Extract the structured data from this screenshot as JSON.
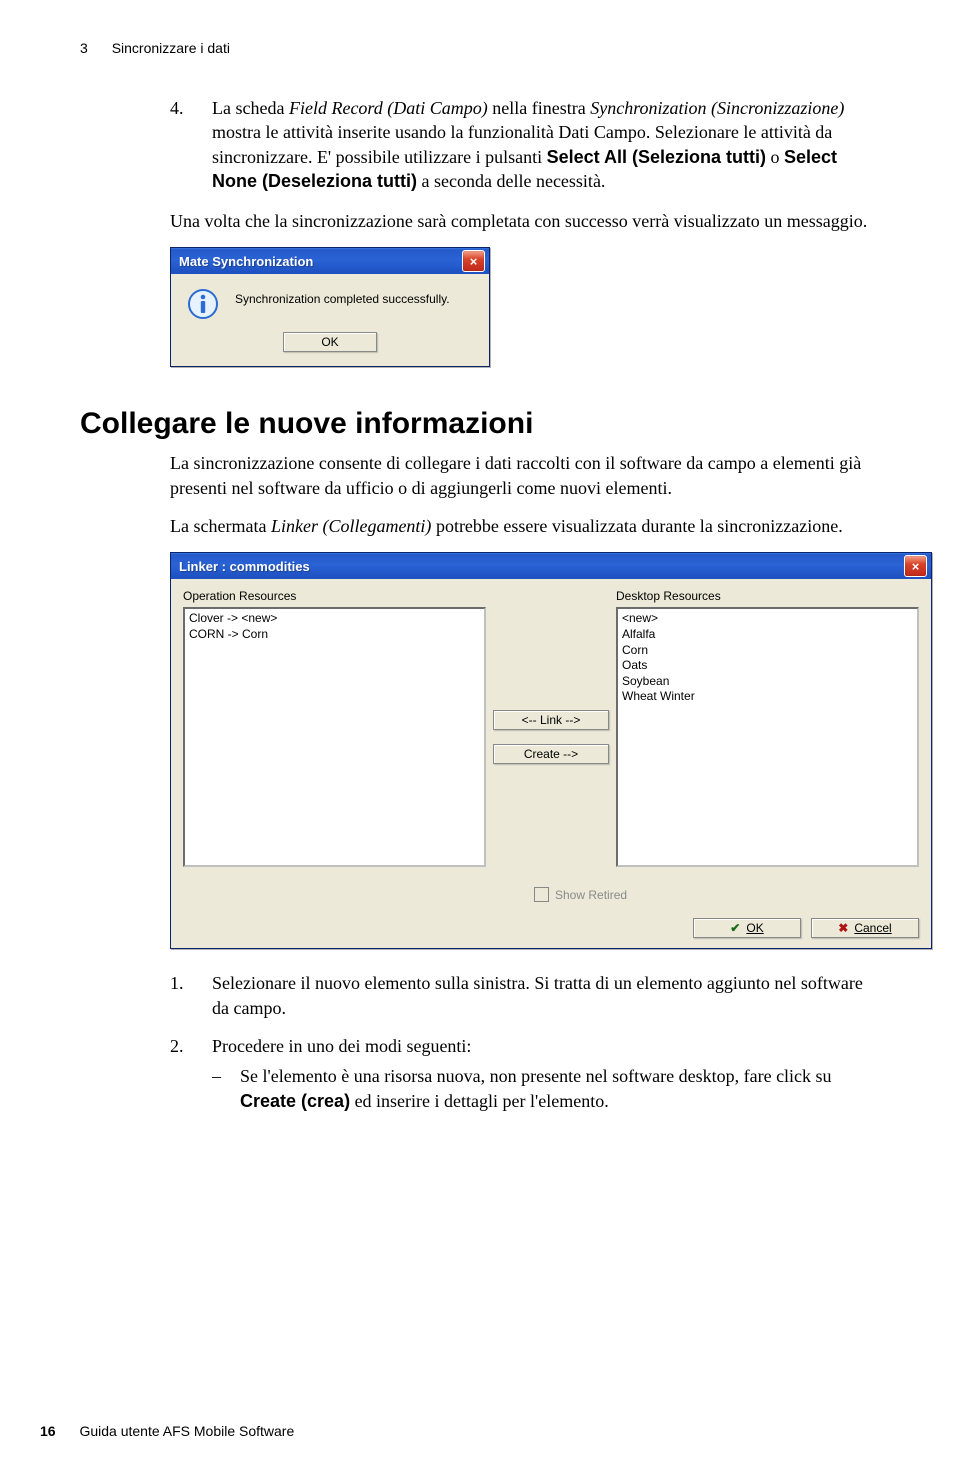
{
  "header": {
    "chapter_num": "3",
    "chapter_title": "Sincronizzare i dati"
  },
  "step4": {
    "num": "4.",
    "part1": "La scheda ",
    "italic1": "Field Record (Dati Campo)",
    "part2": " nella finestra ",
    "italic2": "Synchronization (Sincronizzazione)",
    "part3": " mostra le attività inserite usando la funzionalità Dati Campo. Selezionare le attività da sincronizzare. E' possibile utilizzare i pulsanti ",
    "bold1": "Select All (Seleziona tutti)",
    "part4": " o ",
    "bold2": "Select None (Deseleziona tutti)",
    "part5": " a seconda delle necessità."
  },
  "after_step4": "Una volta che la sincronizzazione sarà completata con successo verrà visualizzato un messaggio.",
  "msgbox": {
    "title": "Mate Synchronization",
    "text": "Synchronization completed successfully.",
    "ok": "OK"
  },
  "section_heading": "Collegare le nuove informazioni",
  "section_p1": "La sincronizzazione consente di collegare i dati raccolti con il software da campo a elementi già presenti nel software da ufficio o di aggiungerli come nuovi elementi.",
  "section_p2_a": "La schermata ",
  "section_p2_i": "Linker (Collegamenti)",
  "section_p2_b": " potrebbe essere visualizzata durante la sincronizzazione.",
  "linker": {
    "title": "Linker : commodities",
    "left_label": "Operation Resources",
    "right_label": "Desktop Resources",
    "left_items": [
      "Clover -> <new>",
      "CORN -> Corn"
    ],
    "right_items": [
      "<new>",
      "Alfalfa",
      "Corn",
      "Oats",
      "Soybean",
      "Wheat Winter"
    ],
    "link_btn": "<-- Link -->",
    "create_btn": "Create -->",
    "show_retired": "Show Retired",
    "ok": "OK",
    "cancel": "Cancel"
  },
  "step1": {
    "num": "1.",
    "text": "Selezionare il nuovo elemento sulla sinistra. Si tratta di un elemento aggiunto nel software da campo."
  },
  "step2": {
    "num": "2.",
    "text": "Procedere in uno dei modi seguenti:",
    "bullet_a": "Se l'elemento è una risorsa nuova, non presente nel software desktop, fare click su ",
    "bullet_bold": "Create (crea)",
    "bullet_b": " ed inserire i dettagli per l'elemento."
  },
  "footer": {
    "page": "16",
    "book": "Guida utente AFS Mobile Software"
  }
}
